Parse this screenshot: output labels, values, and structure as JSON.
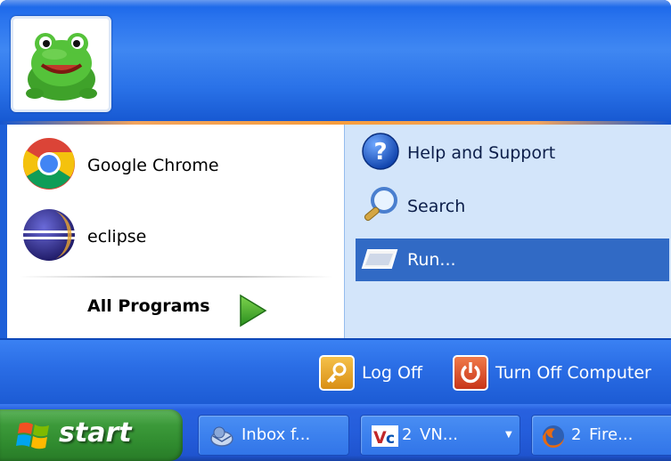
{
  "start_menu": {
    "user_picture": "frog-avatar",
    "pinned": [
      {
        "label": "Google Chrome",
        "icon": "chrome-icon"
      },
      {
        "label": "eclipse",
        "icon": "eclipse-icon"
      }
    ],
    "all_programs_label": "All Programs",
    "right_items": [
      {
        "label": "Help and Support",
        "icon": "help-icon"
      },
      {
        "label": "Search",
        "icon": "search-icon"
      },
      {
        "label": "Run...",
        "icon": "run-icon",
        "selected": true
      }
    ],
    "log_off_label": "Log Off",
    "turn_off_label": "Turn Off Computer"
  },
  "taskbar": {
    "start_label": "start",
    "buttons": [
      {
        "label": "Inbox f...",
        "icon": "mail-icon"
      },
      {
        "count": "2",
        "label": "VN...",
        "icon": "vnc-icon"
      },
      {
        "count": "2",
        "label": "Fire...",
        "icon": "firefox-icon"
      }
    ]
  },
  "colors": {
    "selection": "#316ac5",
    "header_blue": "#2a72e8",
    "right_pane": "#d3e5fa",
    "start_green": "#3c9a3a"
  }
}
